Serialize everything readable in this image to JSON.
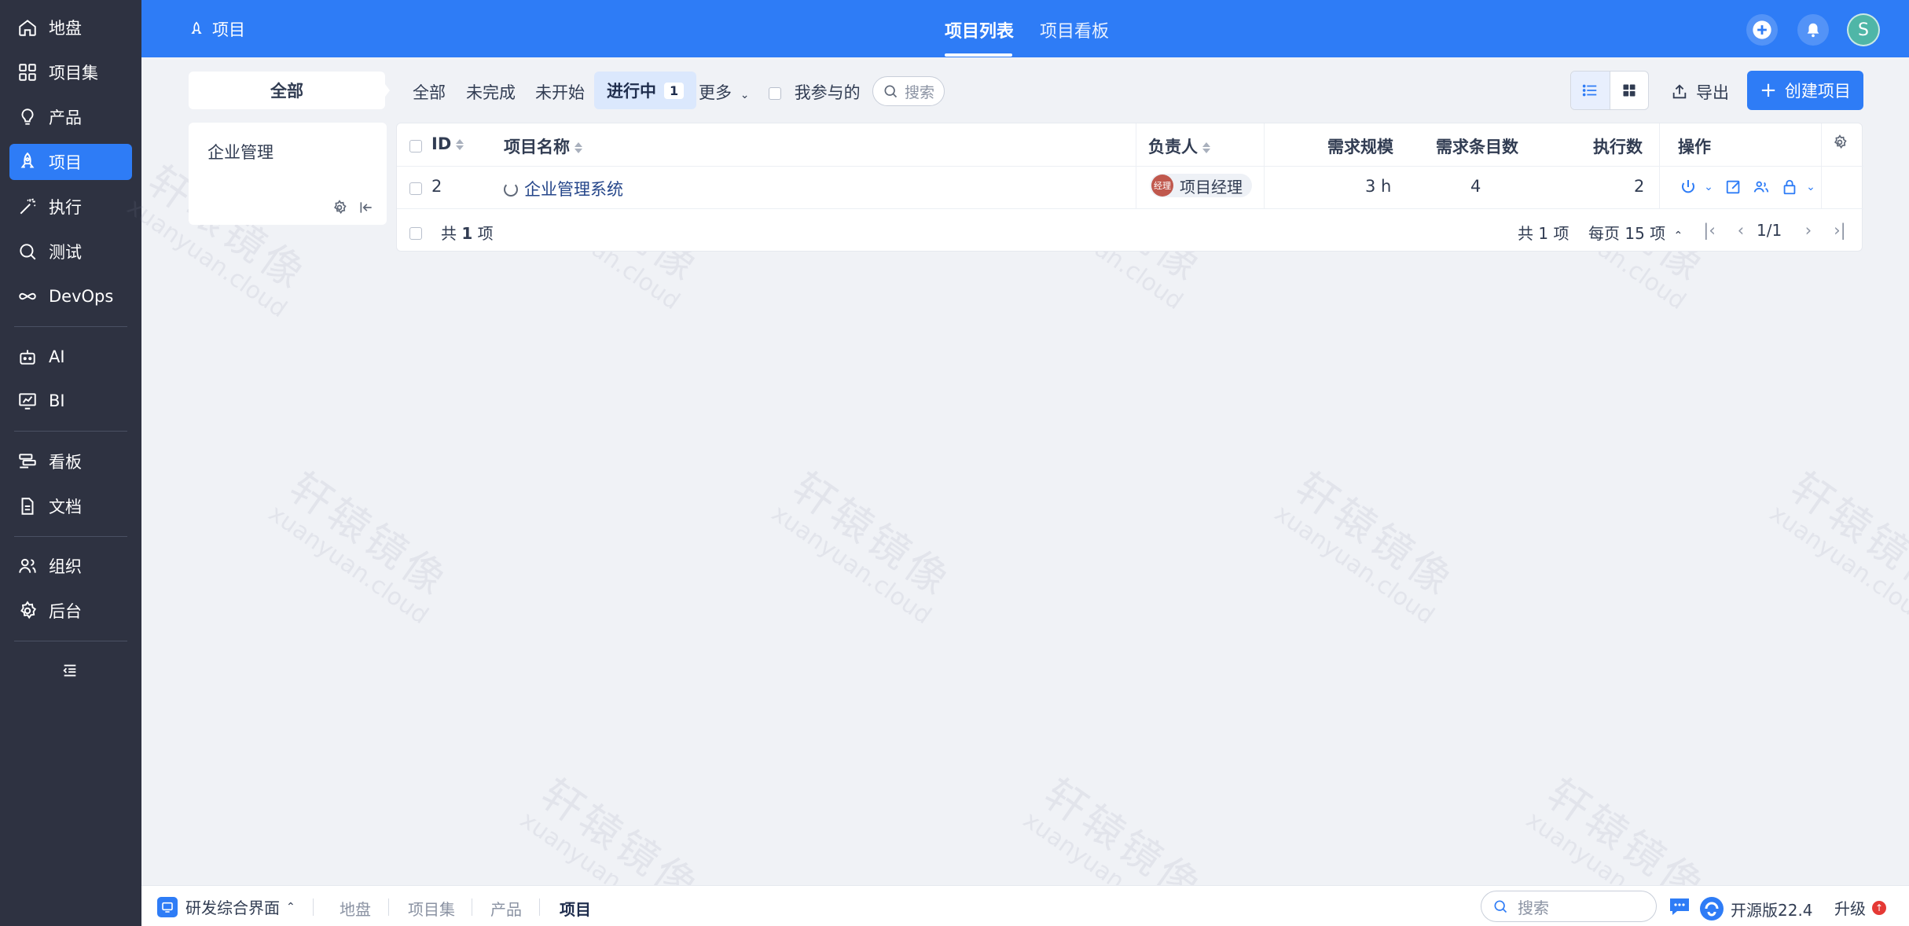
{
  "sidebar": {
    "items": [
      {
        "label": "地盘",
        "icon": "home-icon"
      },
      {
        "label": "项目集",
        "icon": "grid-icon"
      },
      {
        "label": "产品",
        "icon": "lightbulb-icon"
      },
      {
        "label": "项目",
        "icon": "rocket-icon",
        "active": true
      },
      {
        "label": "执行",
        "icon": "wand-icon"
      },
      {
        "label": "测试",
        "icon": "search-check-icon"
      },
      {
        "label": "DevOps",
        "icon": "infinity-icon"
      },
      {
        "label": "AI",
        "icon": "robot-icon"
      },
      {
        "label": "BI",
        "icon": "chart-icon"
      },
      {
        "label": "看板",
        "icon": "kanban-icon"
      },
      {
        "label": "文档",
        "icon": "doc-icon"
      },
      {
        "label": "组织",
        "icon": "users-icon"
      },
      {
        "label": "后台",
        "icon": "gear-icon"
      }
    ]
  },
  "header": {
    "breadcrumb": "项目",
    "tabs": [
      {
        "label": "项目列表",
        "active": true
      },
      {
        "label": "项目看板"
      }
    ]
  },
  "user": {
    "avatar_initial": "S"
  },
  "toolbar": {
    "scope": "全部",
    "filters": [
      "全部",
      "未完成",
      "未开始"
    ],
    "active_filter": {
      "label": "进行中",
      "count": "1"
    },
    "more": "更多",
    "mine_label": "我参与的",
    "search_placeholder": "搜索",
    "export_label": "导出",
    "create_label": "创建项目"
  },
  "group_panel": {
    "name": "企业管理"
  },
  "table": {
    "headers": {
      "id": "ID",
      "name": "项目名称",
      "owner": "负责人",
      "scale": "需求规模",
      "story_count": "需求条目数",
      "exec_count": "执行数",
      "actions": "操作"
    },
    "rows": [
      {
        "id": "2",
        "name": "企业管理系统",
        "owner": "项目经理",
        "owner_avatar": "经理",
        "scale": "3 h",
        "story_count": "4",
        "exec_count": "2"
      }
    ],
    "footer": {
      "total_prefix": "共",
      "total_num": "1",
      "total_suffix": "项",
      "total_right": "共 1 项",
      "per_page": "每页 15 项",
      "page": "1/1"
    }
  },
  "bottombar": {
    "app_label": "研发综合界面",
    "crumbs": [
      "地盘",
      "项目集",
      "产品",
      "项目"
    ],
    "search_placeholder": "搜索",
    "version": "开源版22.4",
    "upgrade": "升级"
  },
  "watermark": {
    "line1": "轩辕镜像",
    "line2": "xuanyuan.cloud"
  },
  "colors": {
    "primary": "#2e7cf6",
    "sidebar_bg": "#2e3241",
    "page_bg": "#f0f2f6"
  }
}
